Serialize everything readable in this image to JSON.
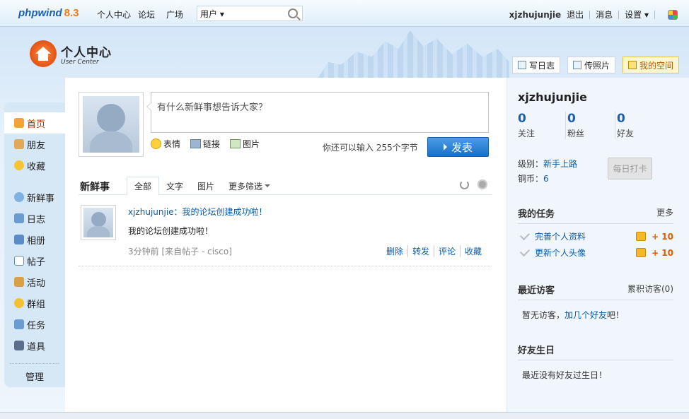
{
  "topbar": {
    "logo": "phpwind",
    "version": "8.3",
    "nav": [
      "个人中心",
      "论坛",
      "广场"
    ],
    "search_scope": "用户",
    "search_value": "",
    "username": "xjzhujunjie",
    "logout": "退出",
    "messages": "消息",
    "settings": "设置"
  },
  "header": {
    "title": "个人中心",
    "subtitle": "User Center",
    "buttons": [
      "写日志",
      "传照片",
      "我的空间"
    ]
  },
  "sidebar": {
    "items": [
      "首页",
      "朋友",
      "收藏",
      "新鲜事",
      "日志",
      "相册",
      "帖子",
      "活动",
      "群组",
      "任务",
      "道具"
    ],
    "admin": "管理"
  },
  "composer": {
    "placeholder": "有什么新鲜事想告诉大家？",
    "tools": [
      "表情",
      "链接",
      "图片"
    ],
    "remaining": "你还可以输入 255个字节",
    "submit": "发表"
  },
  "feed": {
    "title": "新鲜事",
    "tabs": [
      "全部",
      "文字",
      "图片",
      "更多筛选"
    ],
    "items": [
      {
        "user": "xjzhujunjie",
        "headline": "：我的论坛创建成功啦！",
        "text": "我的论坛创建成功啦！",
        "meta": "3分钟前 [来自帖子 - cisco]",
        "actions": [
          "删除",
          "转发",
          "评论",
          "收藏"
        ]
      }
    ]
  },
  "profile": {
    "username": "xjzhujunjie",
    "stats": [
      {
        "value": "0",
        "label": "关注"
      },
      {
        "value": "0",
        "label": "粉丝"
      },
      {
        "value": "0",
        "label": "好友"
      }
    ],
    "level_label": "级别：",
    "level": "新手上路",
    "coins_label": "铜币：",
    "coins": "6",
    "checkin": "每日打卡"
  },
  "tasks": {
    "title": "我的任务",
    "more": "更多",
    "items": [
      {
        "label": "完善个人资料",
        "reward": "+ 10"
      },
      {
        "label": "更新个人头像",
        "reward": "+ 10"
      }
    ]
  },
  "visitors": {
    "title": "最近访客",
    "more": "累积访客(0)",
    "empty_prefix": "暂无访客，",
    "empty_link": "加几个好友",
    "empty_suffix": "吧！"
  },
  "birthdays": {
    "title": "好友生日",
    "empty": "最近没有好友过生日！"
  },
  "colors": {
    "accent": "#1e5fb0",
    "brand_orange": "#ef7a1a",
    "reward": "#e45a00"
  }
}
